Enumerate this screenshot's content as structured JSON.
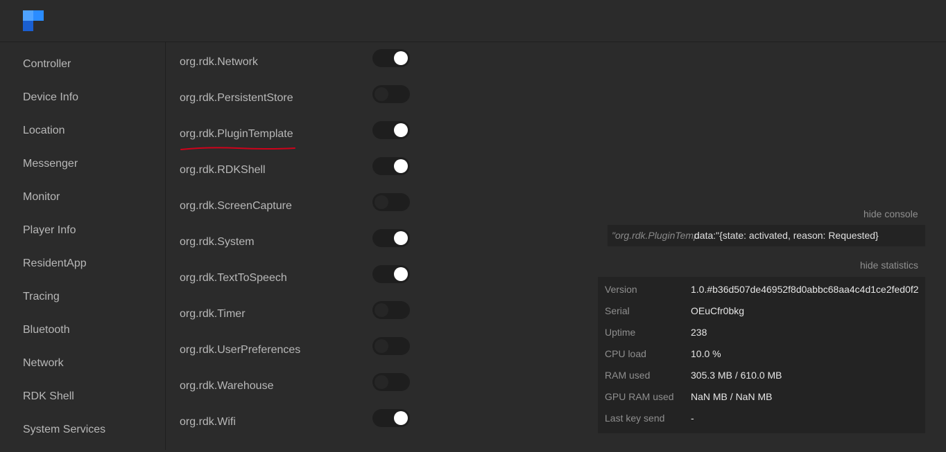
{
  "nav": [
    "Controller",
    "Device Info",
    "Location",
    "Messenger",
    "Monitor",
    "Player Info",
    "ResidentApp",
    "Tracing",
    "Bluetooth",
    "Network",
    "RDK Shell",
    "System Services"
  ],
  "plugins": [
    {
      "name": "org.rdk.Network",
      "enabled": true
    },
    {
      "name": "org.rdk.PersistentStore",
      "enabled": false
    },
    {
      "name": "org.rdk.PluginTemplate",
      "enabled": true
    },
    {
      "name": "org.rdk.RDKShell",
      "enabled": true
    },
    {
      "name": "org.rdk.ScreenCapture",
      "enabled": false
    },
    {
      "name": "org.rdk.System",
      "enabled": true
    },
    {
      "name": "org.rdk.TextToSpeech",
      "enabled": true
    },
    {
      "name": "org.rdk.Timer",
      "enabled": false
    },
    {
      "name": "org.rdk.UserPreferences",
      "enabled": false
    },
    {
      "name": "org.rdk.Warehouse",
      "enabled": false
    },
    {
      "name": "org.rdk.Wifi",
      "enabled": true
    }
  ],
  "annotation_color": "#d0021b",
  "console": {
    "hide_label": "hide console",
    "source": "\"org.rdk.PluginTemp",
    "message": "data:\"{state: activated, reason: Requested}"
  },
  "statistics": {
    "hide_label": "hide statistics",
    "rows": [
      {
        "label": "Version",
        "value": "1.0.#b36d507de46952f8d0abbc68aa4c4d1ce2fed0f2"
      },
      {
        "label": "Serial",
        "value": "OEuCfr0bkg"
      },
      {
        "label": "Uptime",
        "value": "238"
      },
      {
        "label": "CPU load",
        "value": "10.0 %"
      },
      {
        "label": "RAM used",
        "value": "305.3 MB / 610.0 MB"
      },
      {
        "label": "GPU RAM used",
        "value": "NaN MB / NaN MB"
      },
      {
        "label": "Last key send",
        "value": "-"
      }
    ]
  }
}
